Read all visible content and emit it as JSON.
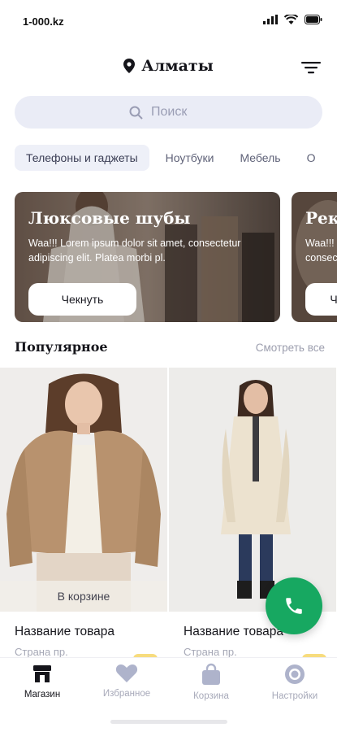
{
  "status": {
    "time": "1-000.kz"
  },
  "header": {
    "city": "Алматы"
  },
  "search": {
    "placeholder": "Поиск"
  },
  "categories": [
    "Телефоны и гаджеты",
    "Ноутбуки",
    "Мебель",
    "О"
  ],
  "banners": [
    {
      "title": "Люксовые шубы",
      "text": "Waa!!! Lorem ipsum dolor sit amet, consectetur adipiscing elit. Platea morbi pl.",
      "button": "Чекнуть"
    },
    {
      "title": "Рек",
      "text": "Waa!!! consec",
      "button": "Ч"
    }
  ],
  "popular": {
    "title": "Популярное",
    "see_all": "Смотреть все"
  },
  "products": [
    {
      "name": "Название товара",
      "country": "Страна пр.",
      "cart_label": "В корзине",
      "coat_color": "#b8926e"
    },
    {
      "name": "Название товара",
      "country": "Страна пр.",
      "coat_color": "#ece2cf"
    }
  ],
  "tabs": [
    {
      "label": "Магазин",
      "icon": "store-icon",
      "active": true
    },
    {
      "label": "Избранное",
      "icon": "heart-icon"
    },
    {
      "label": "Корзина",
      "icon": "bag-icon"
    },
    {
      "label": "Настройки",
      "icon": "settings-icon"
    }
  ],
  "colors": {
    "accent_green": "#17a861",
    "search_bg": "#eaecf6",
    "price_chip": "#f7dc7e"
  }
}
